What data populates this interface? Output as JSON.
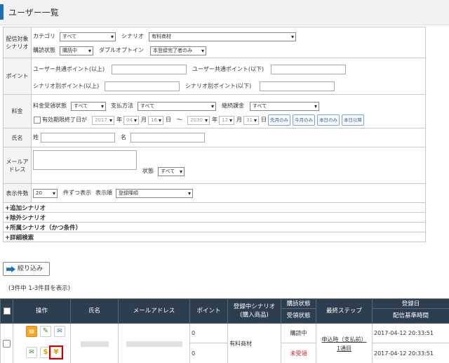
{
  "page": {
    "title": "ユーザー一覧"
  },
  "filters": {
    "target": {
      "label": "配信対象シナリオ",
      "category_label": "カテゴリ",
      "category_value": "すべて",
      "scenario_label": "シナリオ",
      "scenario_value": "有料商材",
      "subscribe_label": "購読状態",
      "subscribe_value": "購読中",
      "double_optin_label": "ダブルオプトイン",
      "double_optin_value": "本登録完了者のみ"
    },
    "points": {
      "label": "ポイント",
      "common_min_label": "ユーザー共通ポイント(以上)",
      "common_max_label": "ユーザー共通ポイント(以下)",
      "scenario_min_label": "シナリオ別ポイント(以上)",
      "scenario_max_label": "シナリオ別ポイント(以下)"
    },
    "fee": {
      "label": "料金",
      "receive_label": "料金受領状態",
      "receive_value": "すべて",
      "payment_label": "支払方法",
      "payment_value": "すべて",
      "continuous_label": "継続課金",
      "continuous_value": "すべて",
      "expiry_label": "有効期限終了日が",
      "from_year": "2017",
      "year_unit": "年",
      "from_month": "04",
      "month_unit": "月",
      "from_day": "16",
      "day_unit": "日",
      "tilde": "～",
      "to_year": "2030",
      "to_month": "12",
      "to_day": "31",
      "btn_last_month": "先月のみ",
      "btn_this_month": "今月のみ",
      "btn_today": "本日のみ",
      "btn_after_today": "本日以降"
    },
    "name": {
      "label": "氏名",
      "last_label": "姓",
      "first_label": "名"
    },
    "email": {
      "label": "メールアドレス",
      "status_label": "状態",
      "status_value": "すべて"
    },
    "display": {
      "label": "表示件数",
      "count_value": "20",
      "each_label": "件ずつ表示",
      "order_label": "表示順",
      "order_value": "登録降順"
    },
    "collapsibles": [
      "+追加シナリオ",
      "+除外シナリオ",
      "+所属シナリオ（かつ条件）",
      "+詳細検索"
    ]
  },
  "narrow_button": "絞り込み",
  "result_count": "(3件中 1-3件目を表示)",
  "table": {
    "headers": {
      "ops": "操作",
      "name": "氏名",
      "email": "メールアドレス",
      "point": "ポイント",
      "scenario": "登録中シナリオ",
      "scenario_sub": "(購入商品)",
      "subscribe": "購読状態",
      "receive": "受領状態",
      "step": "最終ステップ",
      "reg_date": "登録日",
      "base_time": "配信基準時間"
    },
    "rows": [
      {
        "point_1": "0",
        "point_2": "0",
        "scenario": "有料商材",
        "subscribe": "購読中",
        "receive": "未受領",
        "step_1": "申込時（支払前）",
        "step_2": "1通目",
        "reg_date": "2017-04-12 20:33:51",
        "base_time": "2017-04-12 20:33:51"
      }
    ],
    "op_icons": [
      "calendar-icon",
      "pencil-icon",
      "mail-icon",
      "mail-send-icon",
      "dollar-icon",
      "yen-icon"
    ]
  },
  "colors": {
    "header_bg": "#2c3e4f",
    "accent": "#1e6fb8",
    "red_box": "#d00000",
    "red_text": "#d02020"
  }
}
